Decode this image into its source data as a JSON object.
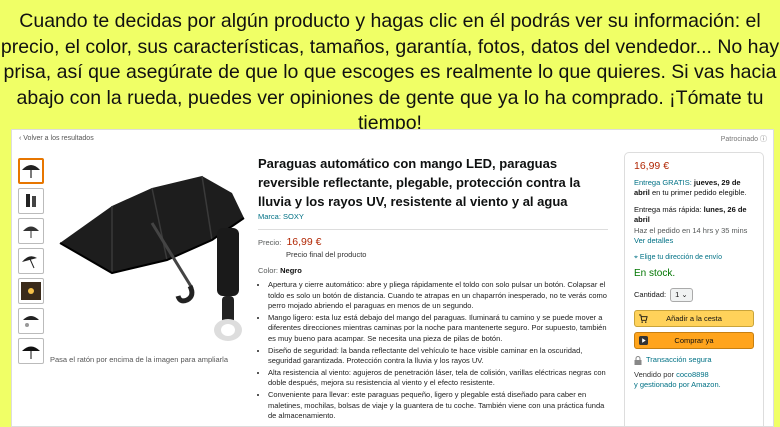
{
  "banner": {
    "text": "Cuando te decidas por algún producto y hagas clic en él podrás ver su información: el precio, el color, sus características, tamaños, garantía, fotos, datos del vendedor... No hay prisa, así que asegúrate de que lo que escoges es realmente lo que quieres. Si vas hacia abajo con la rueda, puedes ver opiniones de gente que ya lo ha comprado. ¡Tómate tu tiempo!"
  },
  "nav": {
    "back_label": "‹ Volver a los resultados",
    "sponsored_label": "Patrocinado ⓘ"
  },
  "gallery": {
    "hint": "Pasa el ratón por encima de la imagen para ampliarla"
  },
  "product": {
    "title": "Paraguas automático con mango LED, paraguas reversible reflectante, plegable, protección contra la lluvia y los rayos UV, resistente al viento y al agua",
    "brand": "Marca: SOXY",
    "price_label": "Precio:",
    "price": "16,99 €",
    "price_note": "Precio final del producto",
    "color_label": "Color:",
    "color_value": "Negro",
    "features": [
      "Apertura y cierre automático: abre y pliega rápidamente el toldo con solo pulsar un botón. Colapsar el toldo es solo un botón de distancia. Cuando te atrapas en un chaparrón inesperado, no te verás como perro mojado abriendo el paraguas en menos de un segundo.",
      "Mango ligero: esta luz está debajo del mango del paraguas. Iluminará tu camino y se puede mover a diferentes direcciones mientras caminas por la noche para mantenerte seguro. Por supuesto, también es muy bueno para acampar. Se necesita una pieza de pilas de botón.",
      "Diseño de seguridad: la banda reflectante del vehículo te hace visible caminar en la oscuridad, seguridad garantizada. Protección contra la lluvia y los rayos UV.",
      "Alta resistencia al viento: agujeros de penetración láser, tela de colisión, varillas eléctricas negras con doble después, mejora su resistencia al viento y el efecto resistente.",
      "Conveniente para llevar: este paraguas pequeño, ligero y plegable está diseñado para caber en maletines, mochilas, bolsas de viaje y la guantera de tu coche. También viene con una práctica funda de almacenamiento."
    ]
  },
  "buybox": {
    "price": "16,99 €",
    "delivery_free_prefix": "Entrega GRATIS:",
    "delivery_free_date": "jueves, 29 de abril",
    "delivery_free_suffix": "en tu primer pedido elegible.",
    "fast_prefix": "Entrega más rápida:",
    "fast_date": "lunes, 26 de abril",
    "order_within": "Haz el pedido en 14 hrs y 35 mins",
    "see_details": "Ver detalles",
    "location": "Elige tu dirección de envío",
    "stock": "En stock.",
    "qty_label": "Cantidad:",
    "qty_value": "1",
    "add_to_cart": "Añadir a la cesta",
    "buy_now": "Comprar ya",
    "secure": "Transacción segura",
    "seller_prefix": "Vendido por",
    "seller": "coco8898",
    "fulfilled_prefix": "y gestionado por",
    "fulfilled": "Amazon."
  },
  "colors": {
    "accent_link": "#007185",
    "price": "#b12704",
    "stock": "#007600",
    "cart_btn": "#ffd25a",
    "buy_btn": "#ffa41c",
    "banner_bg": "#f0ff66"
  },
  "icons": [
    "location-pin-icon",
    "cart-icon",
    "play-icon",
    "lock-icon",
    "umbrella-icon"
  ]
}
